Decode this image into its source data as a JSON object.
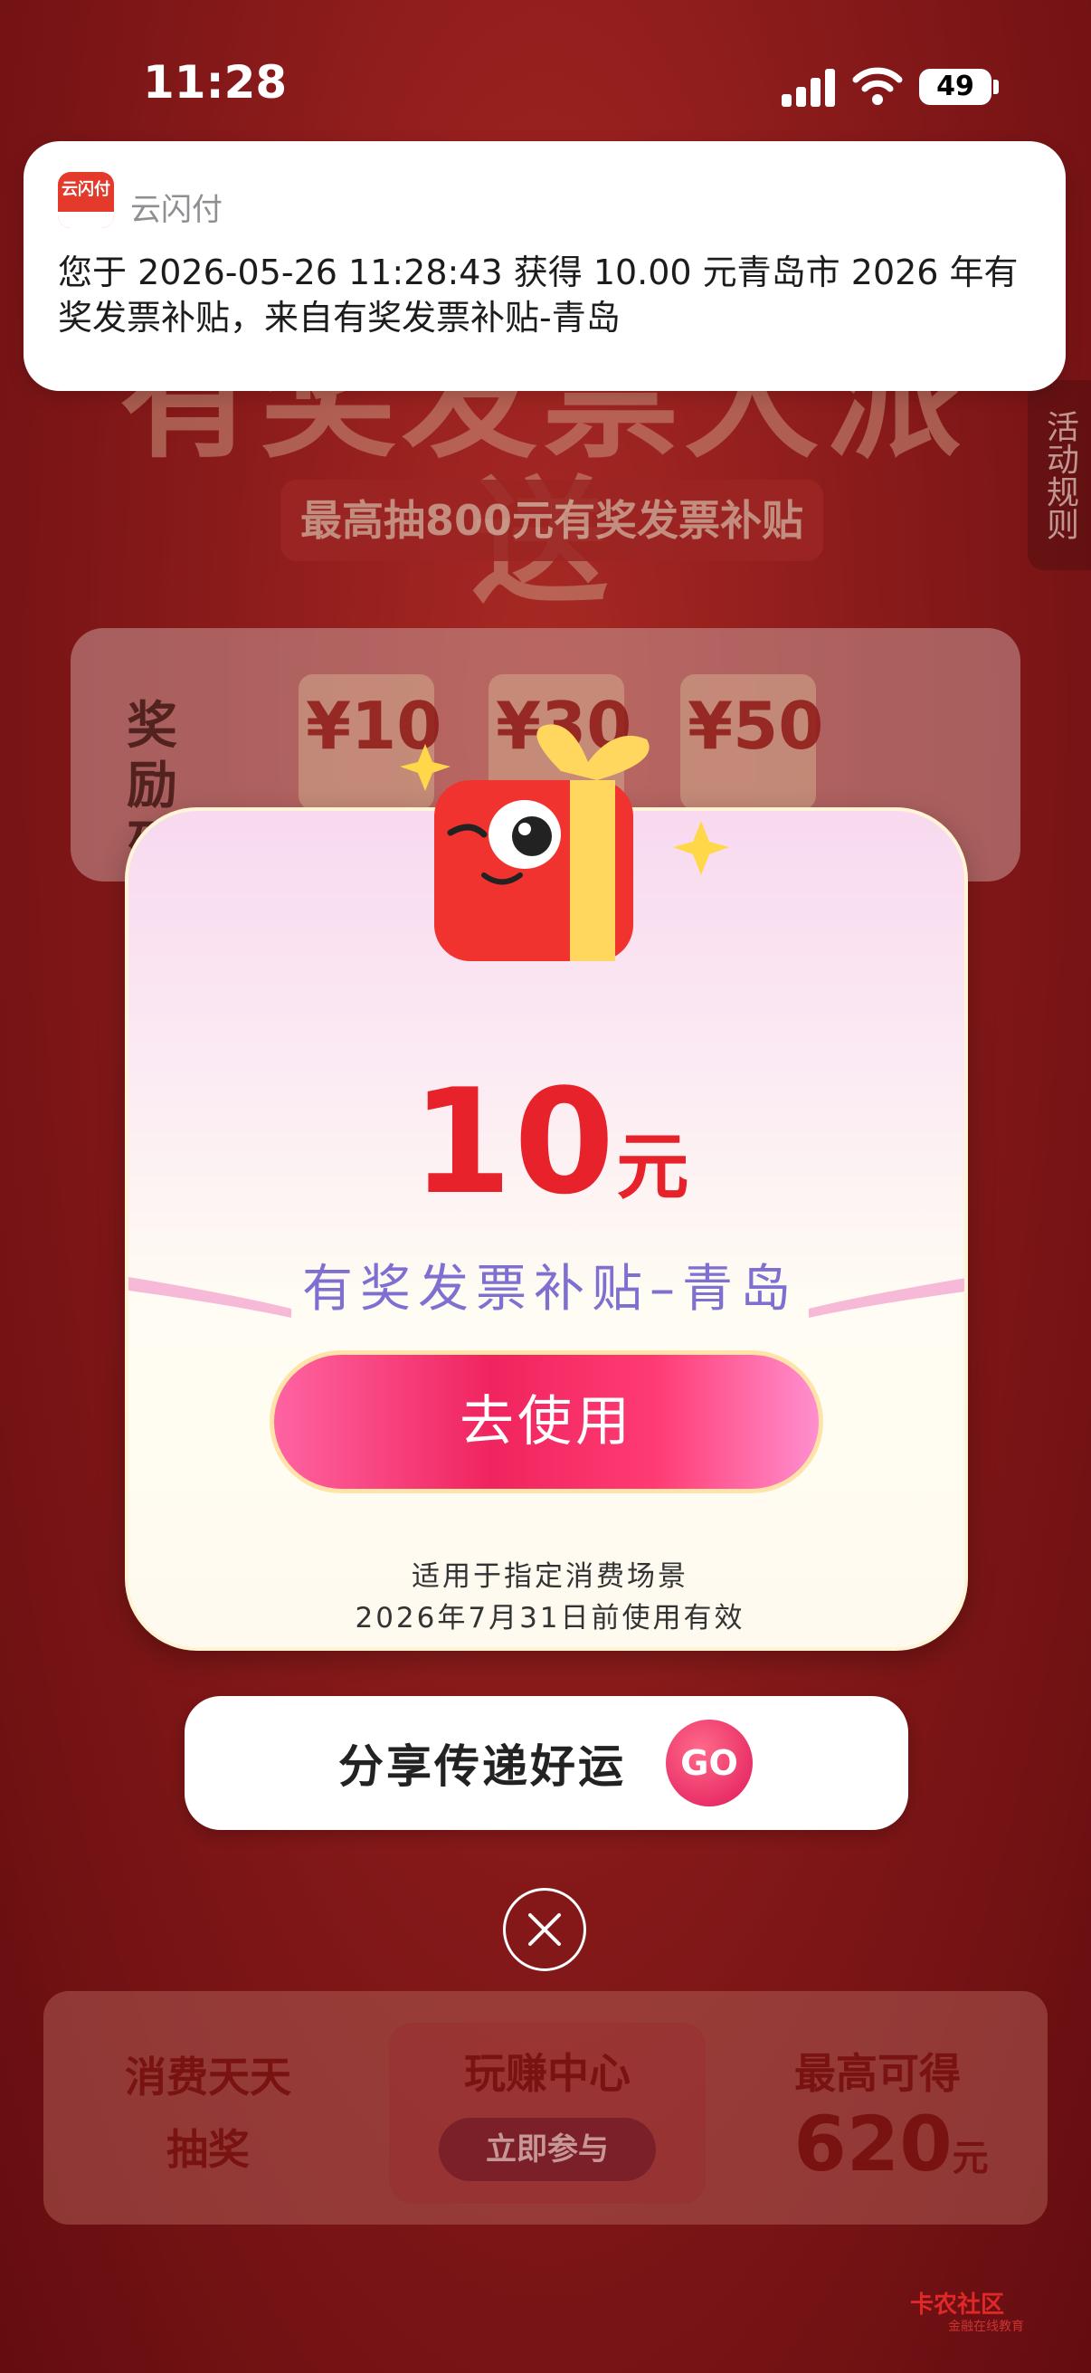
{
  "status_bar": {
    "time": "11:28",
    "battery": "49"
  },
  "notification": {
    "app_name": "云闪付",
    "icon_text": "云闪付",
    "message": "您于 2026-05-26 11:28:43 获得 10.00 元青岛市 2026 年有奖发票补贴，来自有奖发票补贴-青岛"
  },
  "background": {
    "banner_title": "有奖发票大派送",
    "subtitle": "最高抽800元有奖发票补贴",
    "rules_tab": "活动规则",
    "reward_list_label": "奖励列表",
    "reward_amounts": [
      "¥10",
      "¥30",
      "¥50"
    ],
    "bottom_left": [
      "消费天天",
      "抽奖"
    ],
    "bottom_center_title": "玩赚中心",
    "bottom_center_button": "立即参与",
    "bottom_right_title": "最高可得",
    "bottom_right_amount": "620",
    "bottom_right_unit": "元"
  },
  "modal": {
    "amount": "10",
    "unit": "元",
    "prize_name": "有奖发票补贴–青岛",
    "use_button": "去使用",
    "validity_line1": "适用于指定消费场景",
    "validity_line2": "2026年7月31日前使用有效"
  },
  "share": {
    "label": "分享传递好运",
    "go": "GO"
  },
  "watermark": {
    "text": "卡农社区",
    "sub": "金融在线教育"
  },
  "colors": {
    "accent_red": "#e8222a",
    "prize_name_purple": "#7e6fd0",
    "button_pink": "#f0245e"
  }
}
